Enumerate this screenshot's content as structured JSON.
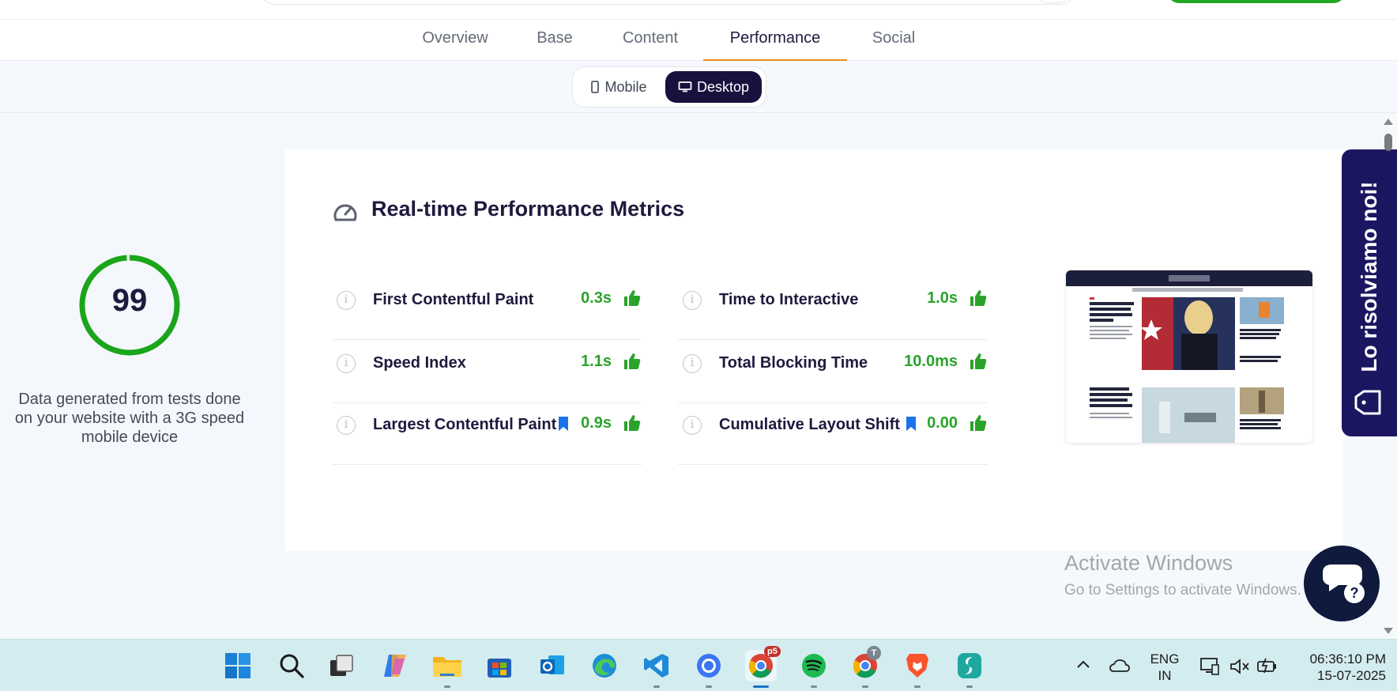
{
  "tabs": [
    {
      "label": "Overview",
      "active": false
    },
    {
      "label": "Base",
      "active": false
    },
    {
      "label": "Content",
      "active": false
    },
    {
      "label": "Performance",
      "active": true
    },
    {
      "label": "Social",
      "active": false
    }
  ],
  "device_toggle": {
    "mobile_label": "Mobile",
    "desktop_label": "Desktop",
    "selected": "Desktop"
  },
  "score": {
    "value": "99",
    "fraction": 0.99,
    "color": "#1aa51a",
    "note": "Data generated from tests done on your website with a 3G speed mobile device"
  },
  "metrics": {
    "title": "Real-time Performance Metrics",
    "title_icon": "speedometer-icon",
    "items": [
      {
        "label": "First Contentful Paint",
        "value": "0.3s",
        "status": "good"
      },
      {
        "label": "Time to Interactive",
        "value": "1.0s",
        "status": "good"
      },
      {
        "label": "Speed Index",
        "value": "1.1s",
        "status": "good"
      },
      {
        "label": "Total Blocking Time",
        "value": "10.0ms",
        "status": "good"
      },
      {
        "label": "Largest Contentful Paint",
        "value": "0.9s",
        "status": "good",
        "flag": "bookmark-icon"
      },
      {
        "label": "Cumulative Layout Shift",
        "value": "0.00",
        "status": "good",
        "flag": "bookmark-icon"
      }
    ]
  },
  "side_banner": {
    "text": "Lo risolviamo noi!",
    "icon": "tag-icon"
  },
  "activate_windows": {
    "title": "Activate Windows",
    "subtitle": "Go to Settings to activate Windows."
  },
  "chat_button": {
    "icon": "chat-help-icon",
    "symbol": "?"
  },
  "taskbar": {
    "apps": [
      "windows-start-icon",
      "search-icon",
      "task-view-icon",
      "copilot-icon",
      "file-explorer-icon",
      "microsoft-store-icon",
      "outlook-icon",
      "edge-icon",
      "vscode-icon",
      "signal-icon",
      "chrome-icon",
      "spotify-icon",
      "chrome-profile-icon",
      "brave-icon",
      "surfshark-icon"
    ],
    "chrome_badge": "p5",
    "chrome_profile_badge": "T",
    "language_line1": "ENG",
    "language_line2": "IN",
    "time": "06:36:10 PM",
    "date": "15-07-2025"
  },
  "colors": {
    "accent_orange": "#f08c1a",
    "navy": "#16113d",
    "good_green": "#2aa32a",
    "bookmark_blue": "#1a73e8",
    "banner": "#1a1760"
  }
}
